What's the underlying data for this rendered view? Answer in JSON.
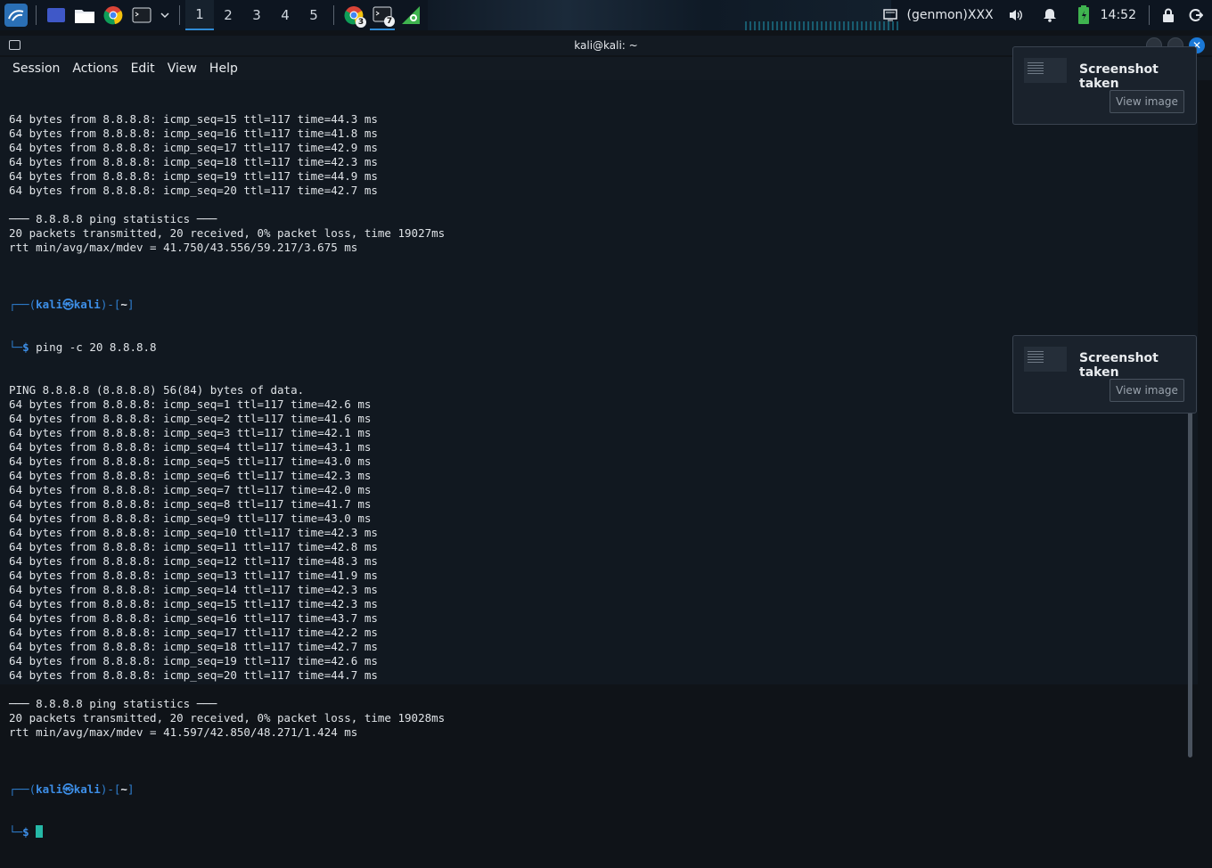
{
  "panel": {
    "workspaces": [
      "1",
      "2",
      "3",
      "4",
      "5"
    ],
    "active_workspace": "1",
    "chrome_badge": "3",
    "terminal_badge": "7",
    "genmon_label": "(genmon)XXX",
    "clock": "14:52"
  },
  "window": {
    "title": "kali@kali: ~",
    "menu": [
      "Session",
      "Actions",
      "Edit",
      "View",
      "Help"
    ]
  },
  "terminal": {
    "block1": [
      "64 bytes from 8.8.8.8: icmp_seq=15 ttl=117 time=44.3 ms",
      "64 bytes from 8.8.8.8: icmp_seq=16 ttl=117 time=41.8 ms",
      "64 bytes from 8.8.8.8: icmp_seq=17 ttl=117 time=42.9 ms",
      "64 bytes from 8.8.8.8: icmp_seq=18 ttl=117 time=42.3 ms",
      "64 bytes from 8.8.8.8: icmp_seq=19 ttl=117 time=44.9 ms",
      "64 bytes from 8.8.8.8: icmp_seq=20 ttl=117 time=42.7 ms",
      "",
      "─── 8.8.8.8 ping statistics ───",
      "20 packets transmitted, 20 received, 0% packet loss, time 19027ms",
      "rtt min/avg/max/mdev = 41.750/43.556/59.217/3.675 ms",
      ""
    ],
    "prompt_user": "kali㉿kali",
    "prompt_dir": "~",
    "command": "ping -c 20 8.8.8.8",
    "block2": [
      "PING 8.8.8.8 (8.8.8.8) 56(84) bytes of data.",
      "64 bytes from 8.8.8.8: icmp_seq=1 ttl=117 time=42.6 ms",
      "64 bytes from 8.8.8.8: icmp_seq=2 ttl=117 time=41.6 ms",
      "64 bytes from 8.8.8.8: icmp_seq=3 ttl=117 time=42.1 ms",
      "64 bytes from 8.8.8.8: icmp_seq=4 ttl=117 time=43.1 ms",
      "64 bytes from 8.8.8.8: icmp_seq=5 ttl=117 time=43.0 ms",
      "64 bytes from 8.8.8.8: icmp_seq=6 ttl=117 time=42.3 ms",
      "64 bytes from 8.8.8.8: icmp_seq=7 ttl=117 time=42.0 ms",
      "64 bytes from 8.8.8.8: icmp_seq=8 ttl=117 time=41.7 ms",
      "64 bytes from 8.8.8.8: icmp_seq=9 ttl=117 time=43.0 ms",
      "64 bytes from 8.8.8.8: icmp_seq=10 ttl=117 time=42.3 ms",
      "64 bytes from 8.8.8.8: icmp_seq=11 ttl=117 time=42.8 ms",
      "64 bytes from 8.8.8.8: icmp_seq=12 ttl=117 time=48.3 ms",
      "64 bytes from 8.8.8.8: icmp_seq=13 ttl=117 time=41.9 ms",
      "64 bytes from 8.8.8.8: icmp_seq=14 ttl=117 time=42.3 ms",
      "64 bytes from 8.8.8.8: icmp_seq=15 ttl=117 time=42.3 ms",
      "64 bytes from 8.8.8.8: icmp_seq=16 ttl=117 time=43.7 ms",
      "64 bytes from 8.8.8.8: icmp_seq=17 ttl=117 time=42.2 ms",
      "64 bytes from 8.8.8.8: icmp_seq=18 ttl=117 time=42.7 ms",
      "64 bytes from 8.8.8.8: icmp_seq=19 ttl=117 time=42.6 ms",
      "64 bytes from 8.8.8.8: icmp_seq=20 ttl=117 time=44.7 ms",
      "",
      "─── 8.8.8.8 ping statistics ───",
      "20 packets transmitted, 20 received, 0% packet loss, time 19028ms",
      "rtt min/avg/max/mdev = 41.597/42.850/48.271/1.424 ms",
      ""
    ]
  },
  "notifications": [
    {
      "title": "Screenshot taken",
      "button": "View image"
    },
    {
      "title": "Screenshot taken",
      "button": "View image"
    }
  ],
  "colors": {
    "accent": "#2f8bd6",
    "prompt": "#3d8fe8",
    "cursor": "#25b8a6"
  }
}
